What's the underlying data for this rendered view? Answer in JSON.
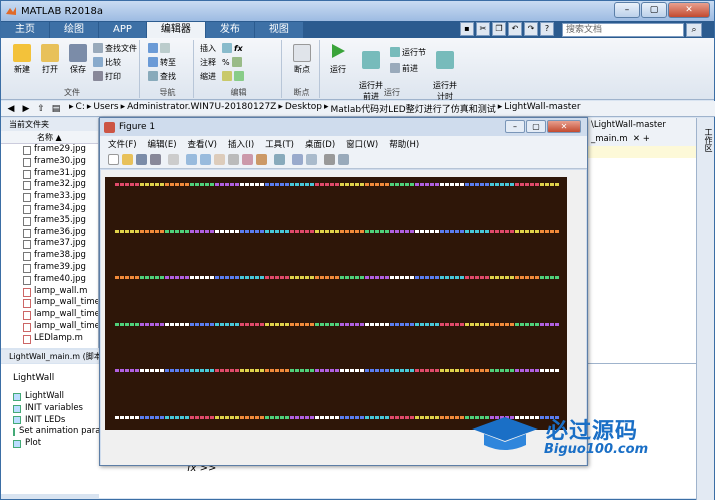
{
  "window": {
    "title": "MATLAB R2018a"
  },
  "ribbon_tabs": [
    "主页",
    "绘图",
    "APP",
    "编辑器",
    "发布",
    "视图"
  ],
  "active_tab": "编辑器",
  "search": {
    "placeholder": "搜索文档"
  },
  "ribbon": {
    "file": {
      "group": "文件",
      "new": "新建",
      "open": "打开",
      "save": "保存",
      "find_files": "查找文件",
      "compare": "比较",
      "print": "打印"
    },
    "nav": {
      "group": "导航",
      "goto": "转至",
      "find": "查找"
    },
    "edit": {
      "group": "编辑",
      "insert": "插入",
      "comment": "注释",
      "indent": "缩进"
    },
    "breakpoint": {
      "group": "断点",
      "label": "断点"
    },
    "run": {
      "group": "运行",
      "run": "运行",
      "run_advance": "运行并\n前进",
      "run_section": "运行节",
      "advance": "前进",
      "run_time": "运行并\n计时"
    }
  },
  "address": {
    "path": [
      "C:",
      "Users",
      "Administrator.WIN7U-20180127Z",
      "Desktop",
      "Matlab代码对LED整灯进行了仿真和测试",
      "LightWall-master"
    ]
  },
  "current_folder": {
    "header": "当前文件夹",
    "col_name": "名称 ▲",
    "files": [
      "frame29.jpg",
      "frame30.jpg",
      "frame31.jpg",
      "frame32.jpg",
      "frame33.jpg",
      "frame34.jpg",
      "frame35.jpg",
      "frame36.jpg",
      "frame37.jpg",
      "frame38.jpg",
      "frame39.jpg",
      "frame40.jpg",
      "lamp_wall.m",
      "lamp_wall_time.m",
      "lamp_wall_time_a",
      "lamp_wall_time_e",
      "LEDlamp.m"
    ]
  },
  "details": {
    "header": "LightWall_main.m  (脚本"
  },
  "workspace": {
    "title": "LightWall",
    "items": [
      "LightWall",
      "INIT variables",
      "INIT LEDs",
      "Set animation para",
      "Plot"
    ]
  },
  "editor": {
    "tab_path": "\\LightWall-master",
    "tab_file": "_main.m",
    "plus": "+"
  },
  "right_sidebar": "工作区",
  "command": {
    "prompt": "fx >>"
  },
  "figure": {
    "title": "Figure 1",
    "menu": [
      "文件(F)",
      "编辑(E)",
      "查看(V)",
      "插入(I)",
      "工具(T)",
      "桌面(D)",
      "窗口(W)",
      "帮助(H)"
    ],
    "background_color": "#2e1608"
  },
  "watermark": {
    "brand": "必过源码",
    "site": "Biguo100.com"
  },
  "colors": {
    "accent": "#2b5b8f",
    "led_palette": [
      "#e04a6a",
      "#4fd07a",
      "#5a7df0",
      "#e0d24a",
      "#b060e0",
      "#48c8d8",
      "#f08a3a",
      "#ffffff"
    ]
  }
}
